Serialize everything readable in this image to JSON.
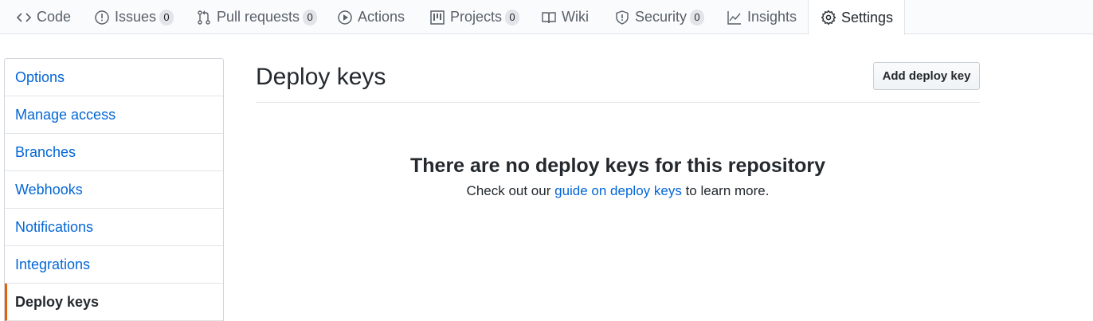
{
  "tabs": [
    {
      "label": "Code",
      "icon": "code-icon"
    },
    {
      "label": "Issues",
      "icon": "issue-icon",
      "count": "0"
    },
    {
      "label": "Pull requests",
      "icon": "pull-request-icon",
      "count": "0"
    },
    {
      "label": "Actions",
      "icon": "play-icon"
    },
    {
      "label": "Projects",
      "icon": "project-icon",
      "count": "0"
    },
    {
      "label": "Wiki",
      "icon": "book-icon"
    },
    {
      "label": "Security",
      "icon": "shield-icon",
      "count": "0"
    },
    {
      "label": "Insights",
      "icon": "graph-icon"
    },
    {
      "label": "Settings",
      "icon": "gear-icon",
      "selected": true
    }
  ],
  "sidebar": {
    "items": [
      {
        "label": "Options"
      },
      {
        "label": "Manage access"
      },
      {
        "label": "Branches"
      },
      {
        "label": "Webhooks"
      },
      {
        "label": "Notifications"
      },
      {
        "label": "Integrations"
      },
      {
        "label": "Deploy keys",
        "active": true
      }
    ]
  },
  "main": {
    "title": "Deploy keys",
    "add_button": "Add deploy key",
    "blankslate": {
      "heading": "There are no deploy keys for this repository",
      "text_before": "Check out our ",
      "link": "guide on deploy keys",
      "text_after": " to learn more."
    }
  },
  "colors": {
    "link": "#0366d6",
    "active_marker": "#e36209",
    "text": "#24292e",
    "muted": "#586069"
  }
}
